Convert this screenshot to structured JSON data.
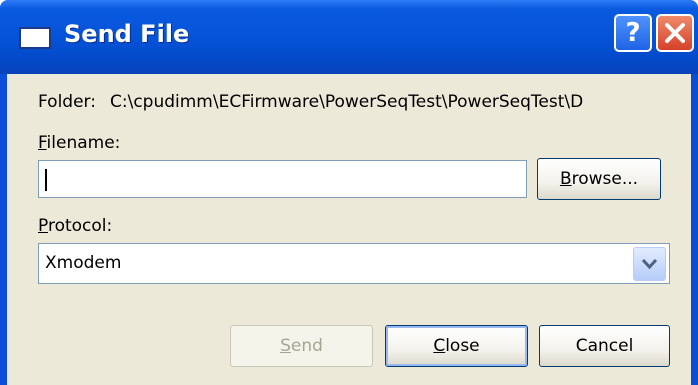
{
  "window": {
    "title": "Send File",
    "help_glyph": "?",
    "close_glyph": "✕"
  },
  "folder": {
    "label": "Folder:",
    "path": "C:\\cpudimm\\ECFirmware\\PowerSeqTest\\PowerSeqTest\\D"
  },
  "filename": {
    "label_mnemonic": "F",
    "label_rest": "ilename:",
    "value": "",
    "browse_mnemonic": "B",
    "browse_rest": "rowse..."
  },
  "protocol": {
    "label_mnemonic": "P",
    "label_rest": "rotocol:",
    "selected": "Xmodem"
  },
  "buttons": {
    "send_mnemonic": "S",
    "send_rest": "end",
    "close_mnemonic": "C",
    "close_rest": "lose",
    "cancel": "Cancel"
  },
  "colors": {
    "titlebar": "#0553d8",
    "dialog_bg": "#ece9d8",
    "input_border": "#7f9db9"
  }
}
